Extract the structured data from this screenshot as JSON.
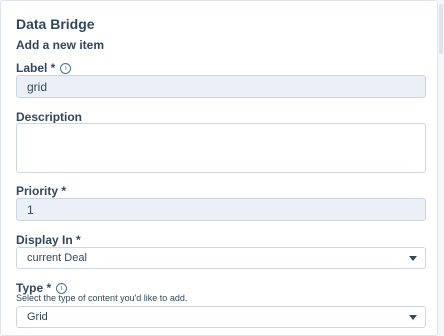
{
  "header": {
    "title": "Data Bridge",
    "subtitle": "Add a new item"
  },
  "fields": {
    "label": {
      "label": "Label *",
      "value": "grid"
    },
    "description": {
      "label": "Description",
      "value": ""
    },
    "priority": {
      "label": "Priority *",
      "value": "1"
    },
    "display_in": {
      "label": "Display In *",
      "value": "current Deal"
    },
    "type": {
      "label": "Type *",
      "help": "Select the type of content you'd like to add.",
      "value": "Grid"
    }
  },
  "icons": {
    "info": "info-icon",
    "caret": "chevron-down-icon"
  },
  "colors": {
    "text": "#33475b",
    "input_bg": "#eaf0f6",
    "border": "#cbd6e2"
  }
}
